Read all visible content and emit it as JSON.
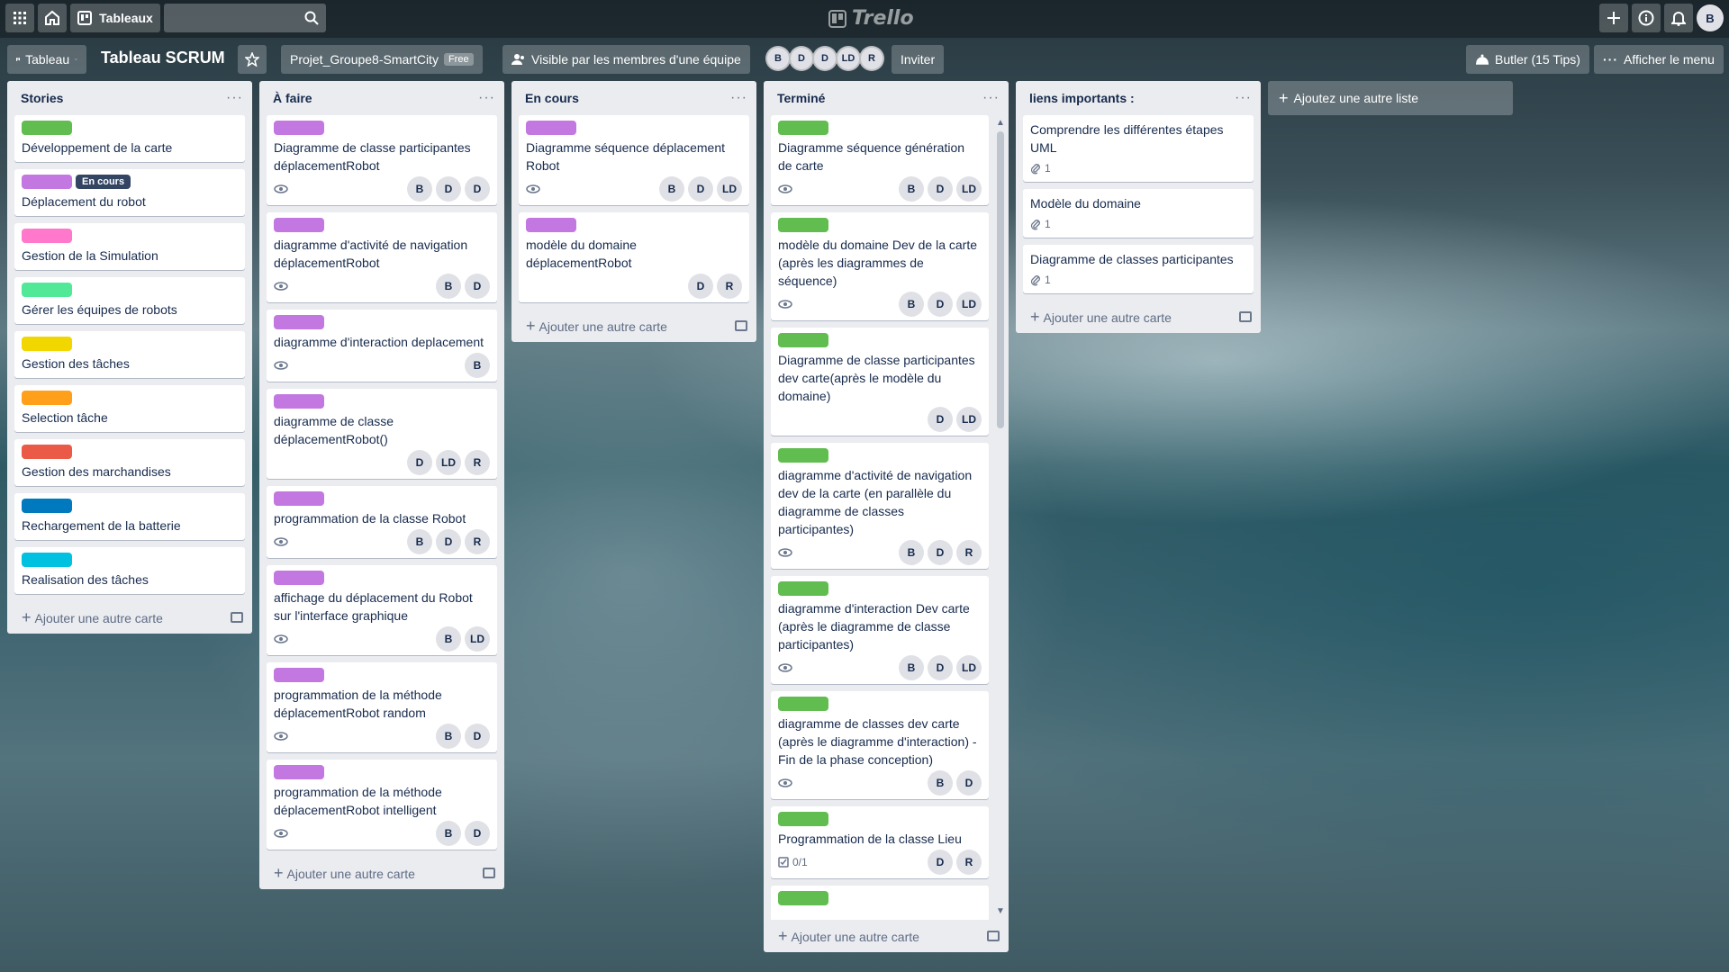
{
  "topbar": {
    "boards_label": "Tableaux",
    "search_placeholder": "",
    "logo_text": "Trello",
    "user_initial": "B"
  },
  "boardbar": {
    "view_label": "Tableau",
    "board_title": "Tableau SCRUM",
    "team_name": "Projet_Groupe8-SmartCity",
    "team_badge": "Free",
    "visibility_label": "Visible par les membres d'une équipe",
    "members": [
      "B",
      "D",
      "D",
      "LD",
      "R"
    ],
    "invite_label": "Inviter",
    "butler_label": "Butler (15 Tips)",
    "menu_label": "Afficher le menu"
  },
  "lists": {
    "stories": {
      "title": "Stories",
      "add_card": "Ajouter une autre carte",
      "cards": [
        {
          "label_color": "#61bd4f",
          "title": "Développement de la carte"
        },
        {
          "label_color": "#c377e0",
          "label_text": "En cours",
          "title": "Déplacement du robot"
        },
        {
          "label_color": "#ff78cb",
          "title": "Gestion de la Simulation"
        },
        {
          "label_color": "#51e898",
          "title": "Gérer les équipes de robots"
        },
        {
          "label_color": "#f2d600",
          "title": "Gestion des tâches"
        },
        {
          "label_color": "#ff9f1a",
          "title": "Selection tâche"
        },
        {
          "label_color": "#eb5a46",
          "title": "Gestion des marchandises"
        },
        {
          "label_color": "#0079bf",
          "title": "Rechargement de la batterie"
        },
        {
          "label_color": "#00c2e0",
          "title": "Realisation des tâches"
        }
      ]
    },
    "todo": {
      "title": "À faire",
      "add_card": "Ajouter une autre carte",
      "cards": [
        {
          "label_color": "#c377e0",
          "title": "Diagramme de classe participantes déplacementRobot",
          "members": [
            "B",
            "D",
            "D"
          ]
        },
        {
          "label_color": "#c377e0",
          "title": "diagramme d'activité de navigation déplacementRobot",
          "members": [
            "B",
            "D"
          ]
        },
        {
          "label_color": "#c377e0",
          "title": "diagramme d'interaction deplacement",
          "members": [
            "B"
          ]
        },
        {
          "label_color": "#c377e0",
          "title": "diagramme de classe déplacementRobot()",
          "members": [
            "D",
            "LD",
            "R"
          ]
        },
        {
          "label_color": "#c377e0",
          "title": "programmation de la classe Robot",
          "members": [
            "B",
            "D",
            "R"
          ]
        },
        {
          "label_color": "#c377e0",
          "title": "affichage du déplacement du Robot sur l'interface graphique",
          "members": [
            "B",
            "LD"
          ]
        },
        {
          "label_color": "#c377e0",
          "title": "programmation de la méthode déplacementRobot random",
          "members": [
            "B",
            "D"
          ]
        },
        {
          "label_color": "#c377e0",
          "title": "programmation de la méthode déplacementRobot intelligent",
          "members": [
            "B",
            "D"
          ]
        }
      ]
    },
    "inprogress": {
      "title": "En cours",
      "add_card": "Ajouter une autre carte",
      "cards": [
        {
          "label_color": "#c377e0",
          "title": "Diagramme séquence déplacement Robot",
          "members": [
            "B",
            "D",
            "LD"
          ]
        },
        {
          "label_color": "#c377e0",
          "title": "modèle du domaine déplacementRobot",
          "members": [
            "D",
            "R"
          ]
        }
      ]
    },
    "done": {
      "title": "Terminé",
      "add_card": "Ajouter une autre carte",
      "cards": [
        {
          "label_color": "#61bd4f",
          "title": "Diagramme séquence génération de carte",
          "members": [
            "B",
            "D",
            "LD"
          ]
        },
        {
          "label_color": "#61bd4f",
          "title": "modèle du domaine Dev de la carte (après les diagrammes de séquence)",
          "members": [
            "B",
            "D",
            "LD"
          ]
        },
        {
          "label_color": "#61bd4f",
          "title": "Diagramme de classe participantes dev carte(après le modèle du domaine)",
          "members": [
            "D",
            "LD"
          ]
        },
        {
          "label_color": "#61bd4f",
          "title": "diagramme d'activité de navigation dev de la carte (en parallèle du diagramme de classes participantes)",
          "members": [
            "B",
            "D",
            "R"
          ]
        },
        {
          "label_color": "#61bd4f",
          "title": "diagramme d'interaction Dev carte (après le diagramme de classe participantes)",
          "members": [
            "B",
            "D",
            "LD"
          ]
        },
        {
          "label_color": "#61bd4f",
          "title": "diagramme de classes dev carte (après le diagramme d'interaction) - Fin de la phase conception)",
          "members": [
            "B",
            "D"
          ]
        },
        {
          "label_color": "#61bd4f",
          "title": "Programmation de la classe Lieu",
          "checklist": "0/1",
          "members": [
            "D",
            "R"
          ]
        }
      ]
    },
    "links": {
      "title": "liens importants :",
      "add_card": "Ajouter une autre carte",
      "cards": [
        {
          "title": "Comprendre les différentes étapes UML",
          "attachments": "1"
        },
        {
          "title": "Modèle du domaine",
          "attachments": "1"
        },
        {
          "title": "Diagramme de classes participantes",
          "attachments": "1"
        }
      ]
    }
  },
  "add_list_label": "Ajoutez une autre liste"
}
